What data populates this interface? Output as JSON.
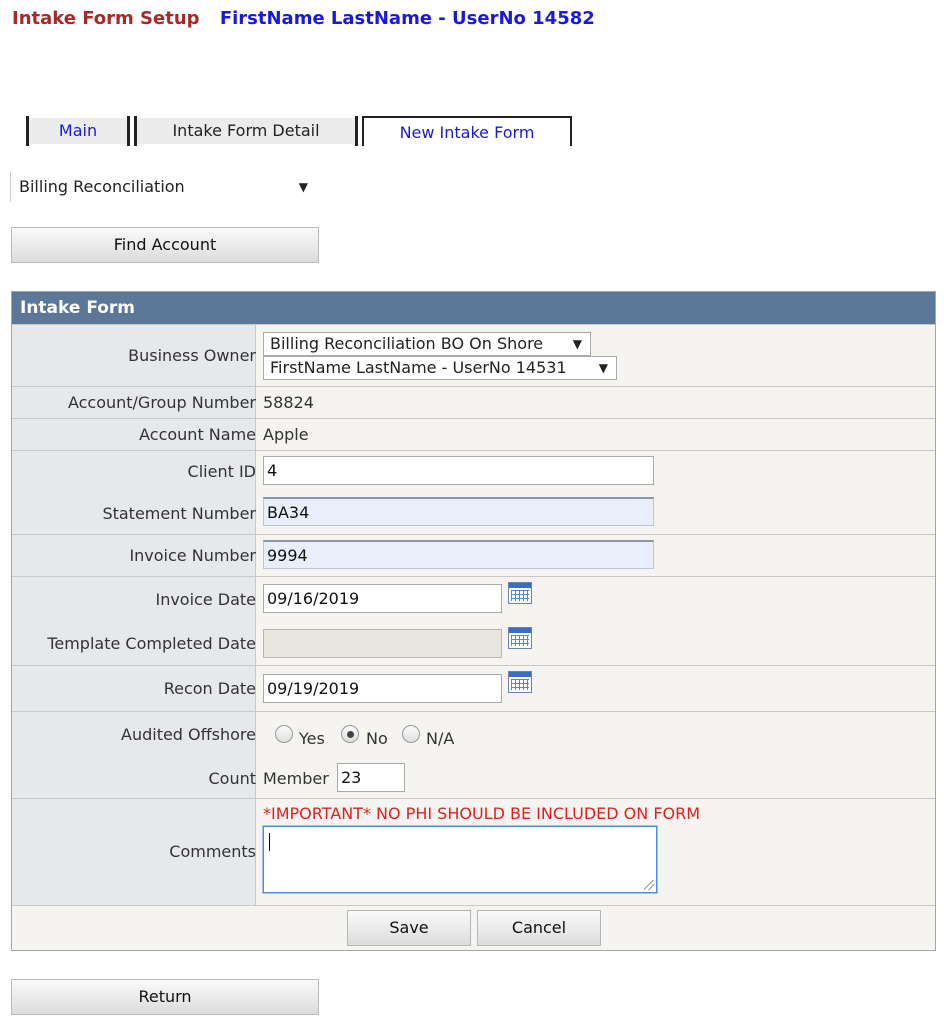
{
  "header": {
    "title": "Intake Form Setup",
    "user": "FirstName LastName - UserNo 14582"
  },
  "tabs": [
    {
      "label": "Main",
      "active": false
    },
    {
      "label": "Intake Form Detail",
      "active": false
    },
    {
      "label": "New Intake Form",
      "active": true
    }
  ],
  "top_select": {
    "value": "Billing Reconciliation"
  },
  "find_account_label": "Find Account",
  "form": {
    "heading": "Intake Form",
    "business_owner": {
      "label": "Business Owner",
      "group_value": "Billing Reconciliation BO On Shore",
      "user_value": "FirstName LastName - UserNo 14531"
    },
    "account_group_number": {
      "label": "Account/Group Number",
      "value": "58824"
    },
    "account_name": {
      "label": "Account Name",
      "value": "Apple"
    },
    "client_id": {
      "label": "Client ID",
      "value": "4"
    },
    "statement_number": {
      "label": "Statement Number",
      "value": "BA34"
    },
    "invoice_number": {
      "label": "Invoice Number",
      "value": "9994"
    },
    "invoice_date": {
      "label": "Invoice Date",
      "value": "09/16/2019"
    },
    "template_completed_date": {
      "label": "Template Completed Date",
      "value": ""
    },
    "recon_date": {
      "label": "Recon Date",
      "value": "09/19/2019"
    },
    "audited_offshore": {
      "label": "Audited Offshore",
      "options": [
        "Yes",
        "No",
        "N/A"
      ],
      "selected": "No"
    },
    "count": {
      "label": "Count",
      "member_label": "Member",
      "value": "23"
    },
    "comments": {
      "label": "Comments",
      "warning": "*IMPORTANT* NO PHI SHOULD BE INCLUDED ON FORM",
      "value": ""
    },
    "save_label": "Save",
    "cancel_label": "Cancel"
  },
  "return_label": "Return",
  "colors": {
    "title": "#a52a2a",
    "user": "#1a1ad6",
    "panel_header": "#5b7898",
    "warning": "#e02020"
  }
}
